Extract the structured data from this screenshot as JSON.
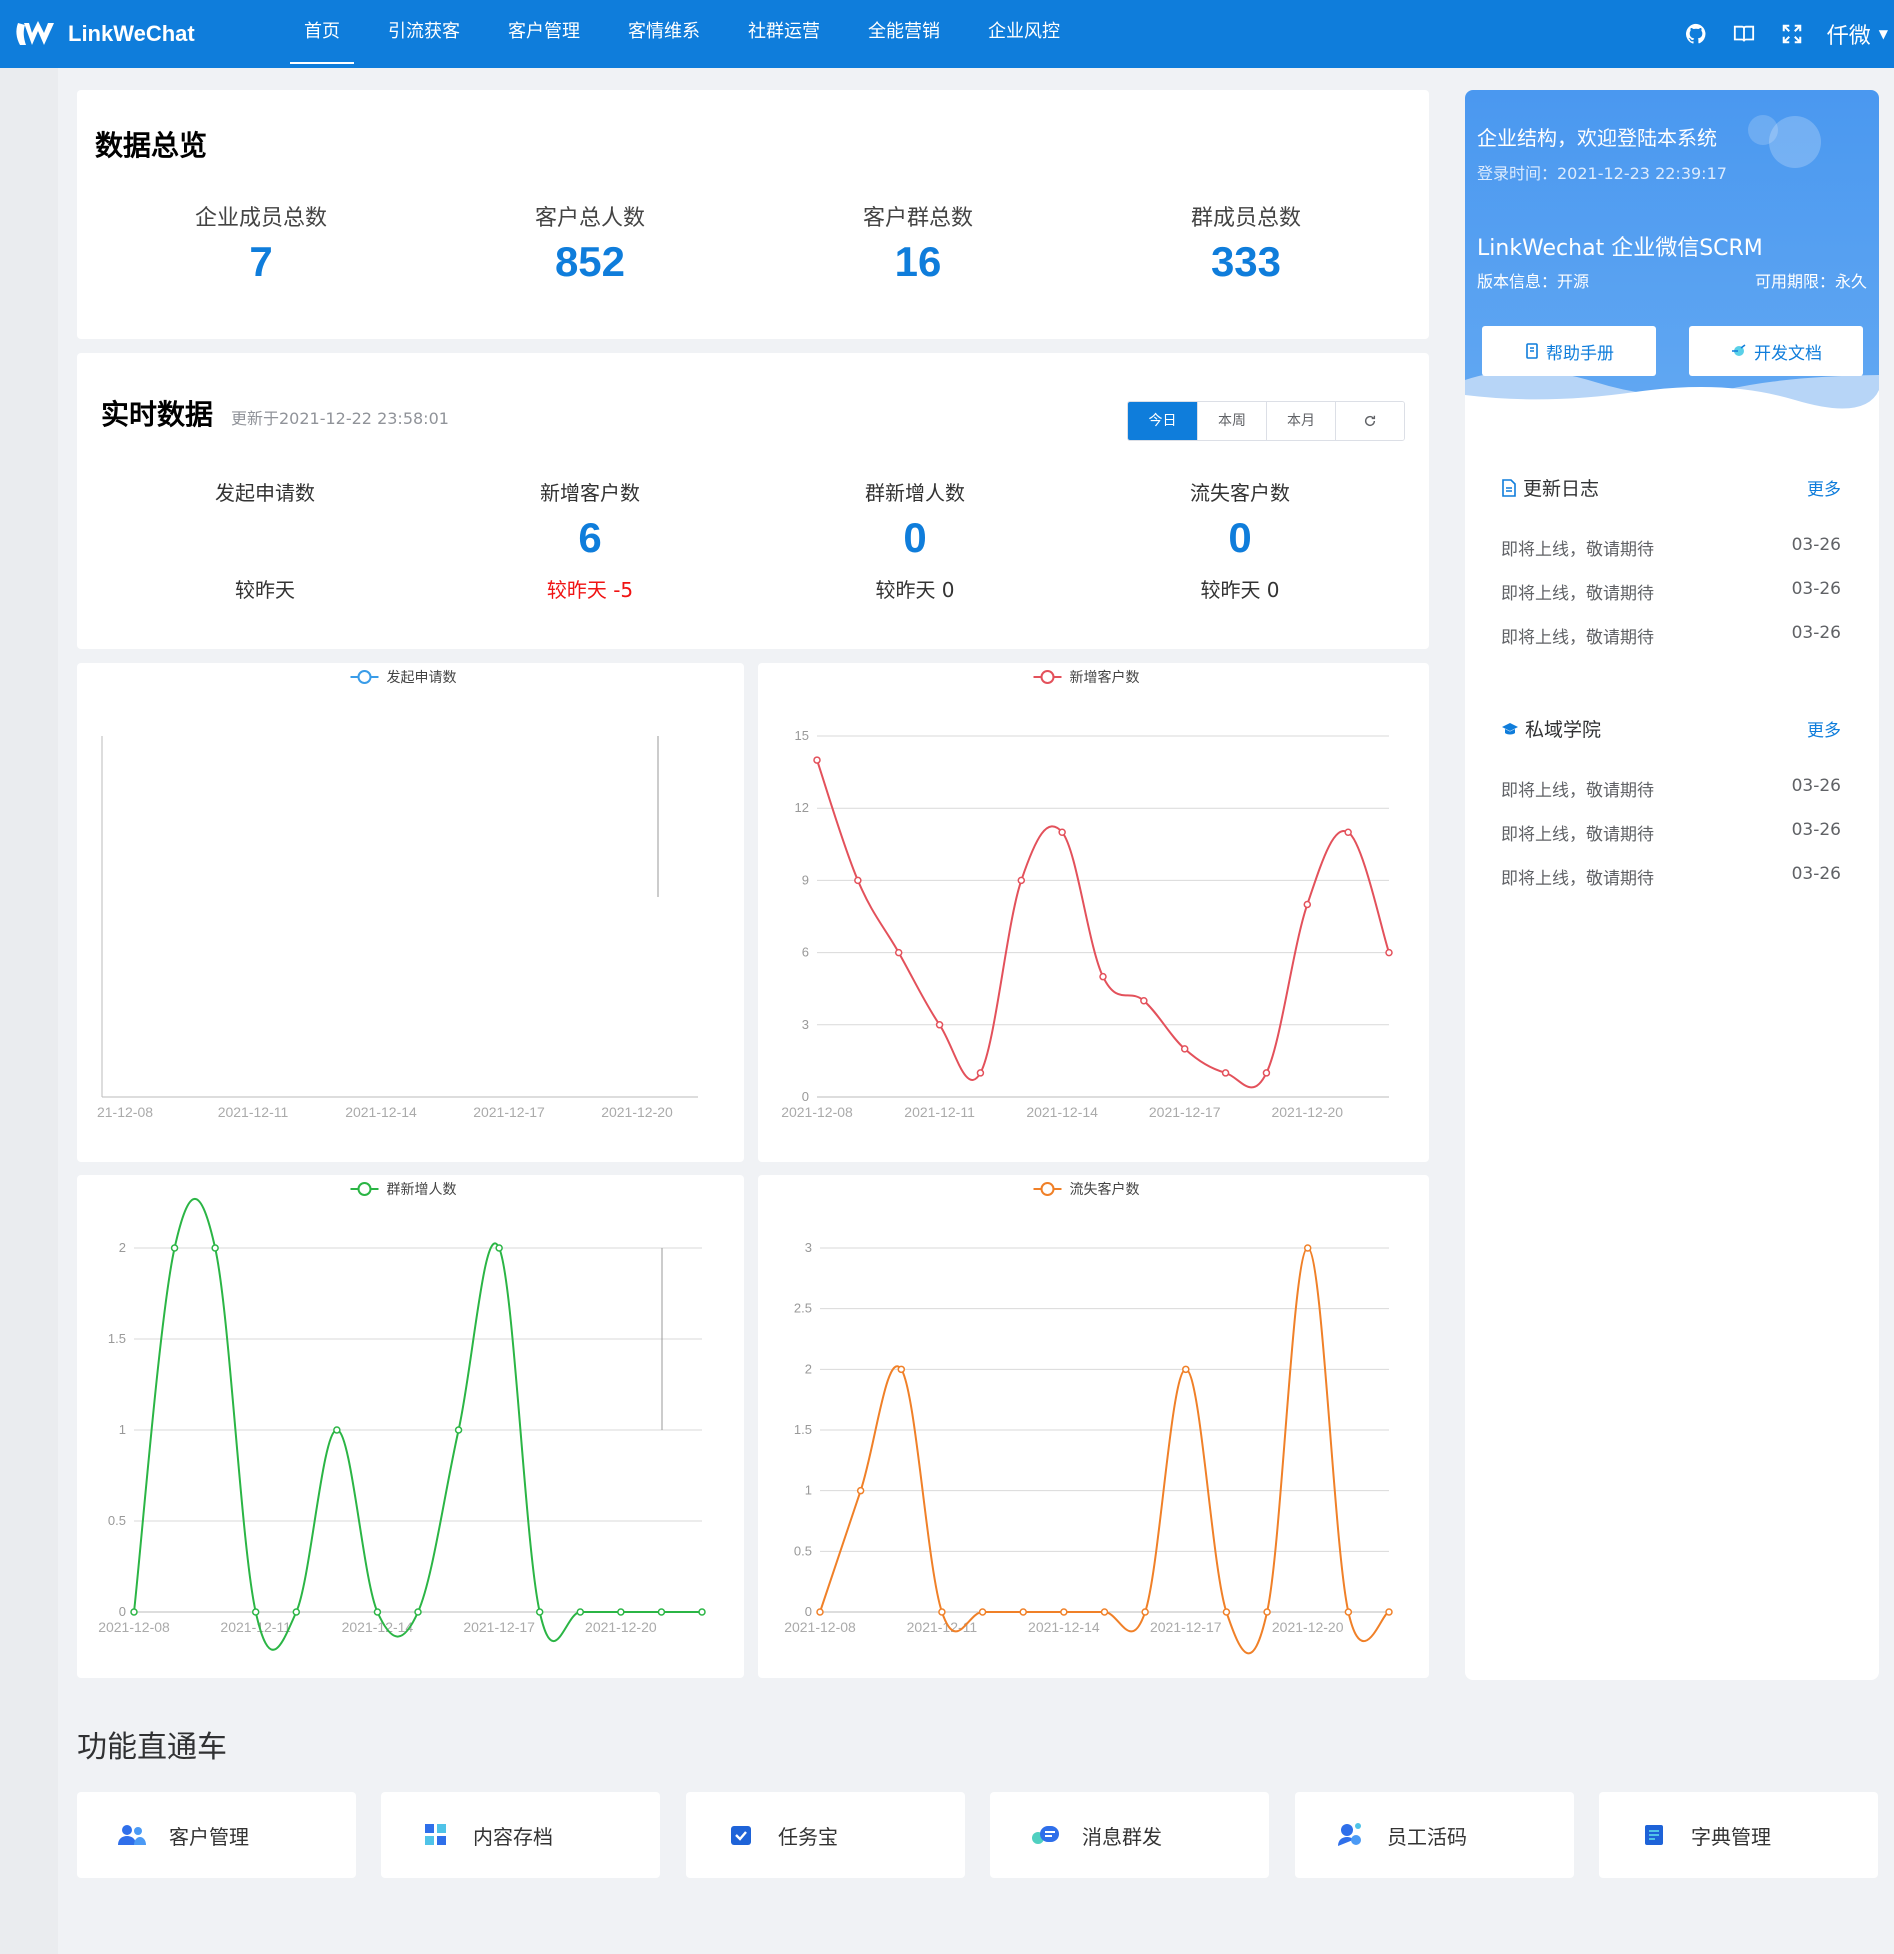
{
  "brand": {
    "name": "LinkWeChat"
  },
  "nav": [
    "首页",
    "引流获客",
    "客户管理",
    "客情维系",
    "社群运营",
    "全能营销",
    "企业风控"
  ],
  "user": {
    "name": "仟微"
  },
  "icons": {
    "top_right": [
      "github-icon",
      "book-icon",
      "fullscreen-icon"
    ]
  },
  "colors": {
    "primary": "#0f7ddb",
    "negative": "#f01313",
    "series": [
      "#3a9ce8",
      "#e3515b",
      "#2bb545",
      "#f08028"
    ]
  },
  "overview": {
    "title": "数据总览",
    "stats": [
      {
        "label": "企业成员总数",
        "value": "7"
      },
      {
        "label": "客户总人数",
        "value": "852"
      },
      {
        "label": "客户群总数",
        "value": "16"
      },
      {
        "label": "群成员总数",
        "value": "333"
      }
    ]
  },
  "realtime": {
    "title": "实时数据",
    "updated": "更新于2021-12-22 23:58:01",
    "periods": [
      "今日",
      "本周",
      "本月"
    ],
    "active_period": "今日",
    "stats": [
      {
        "label": "发起申请数",
        "value": "",
        "compare": "较昨天"
      },
      {
        "label": "新增客户数",
        "value": "6",
        "compare": "较昨天 -5"
      },
      {
        "label": "群新增人数",
        "value": "0",
        "compare": "较昨天 0"
      },
      {
        "label": "流失客户数",
        "value": "0",
        "compare": "较昨天 0"
      }
    ]
  },
  "chart_data": [
    {
      "type": "line",
      "series": [
        {
          "name": "发起申请数",
          "values": []
        }
      ],
      "x": [
        "2021-12-08",
        "2021-12-09",
        "2021-12-10",
        "2021-12-11",
        "2021-12-12",
        "2021-12-13",
        "2021-12-14",
        "2021-12-15",
        "2021-12-16",
        "2021-12-17",
        "2021-12-18",
        "2021-12-19",
        "2021-12-20",
        "2021-12-21",
        "2021-12-22"
      ],
      "tick_labels": [
        "21-12-08",
        "2021-12-11",
        "2021-12-14",
        "2021-12-17",
        "2021-12-20"
      ],
      "yticks": [],
      "ylim": [
        0,
        1
      ]
    },
    {
      "type": "line",
      "series": [
        {
          "name": "新增客户数",
          "values": [
            14,
            9,
            6,
            3,
            1,
            9,
            11,
            5,
            4,
            2,
            1,
            1,
            8,
            11,
            6
          ]
        }
      ],
      "x": [
        "2021-12-08",
        "2021-12-09",
        "2021-12-10",
        "2021-12-11",
        "2021-12-12",
        "2021-12-13",
        "2021-12-14",
        "2021-12-15",
        "2021-12-16",
        "2021-12-17",
        "2021-12-18",
        "2021-12-19",
        "2021-12-20",
        "2021-12-21",
        "2021-12-22"
      ],
      "tick_labels": [
        "2021-12-08",
        "2021-12-11",
        "2021-12-14",
        "2021-12-17",
        "2021-12-20"
      ],
      "yticks": [
        "0",
        "3",
        "6",
        "9",
        "12",
        "15"
      ],
      "ylim": [
        0,
        15
      ]
    },
    {
      "type": "line",
      "series": [
        {
          "name": "群新增人数",
          "values": [
            0,
            2,
            2,
            0,
            0,
            1,
            0,
            0,
            1,
            2,
            0,
            0,
            0,
            0,
            0
          ]
        }
      ],
      "x": [
        "2021-12-08",
        "2021-12-09",
        "2021-12-10",
        "2021-12-11",
        "2021-12-12",
        "2021-12-13",
        "2021-12-14",
        "2021-12-15",
        "2021-12-16",
        "2021-12-17",
        "2021-12-18",
        "2021-12-19",
        "2021-12-20",
        "2021-12-21",
        "2021-12-22"
      ],
      "tick_labels": [
        "2021-12-08",
        "2021-12-11",
        "2021-12-14",
        "2021-12-17",
        "2021-12-20"
      ],
      "yticks": [
        "0",
        "0.5",
        "1",
        "1.5",
        "2"
      ],
      "ylim": [
        0,
        2
      ]
    },
    {
      "type": "line",
      "series": [
        {
          "name": "流失客户数",
          "values": [
            0,
            1,
            2,
            0,
            0,
            0,
            0,
            0,
            0,
            2,
            0,
            0,
            3,
            0,
            0
          ]
        }
      ],
      "x": [
        "2021-12-08",
        "2021-12-09",
        "2021-12-10",
        "2021-12-11",
        "2021-12-12",
        "2021-12-13",
        "2021-12-14",
        "2021-12-15",
        "2021-12-16",
        "2021-12-17",
        "2021-12-18",
        "2021-12-19",
        "2021-12-20",
        "2021-12-21",
        "2021-12-22"
      ],
      "tick_labels": [
        "2021-12-08",
        "2021-12-11",
        "2021-12-14",
        "2021-12-17",
        "2021-12-20"
      ],
      "yticks": [
        "0",
        "0.5",
        "1",
        "1.5",
        "2",
        "2.5",
        "3"
      ],
      "ylim": [
        0,
        3
      ]
    }
  ],
  "panel": {
    "welcome": "企业结构，欢迎登陆本系统",
    "login_time": "登录时间：2021-12-23 22:39:17",
    "product": "LinkWechat 企业微信SCRM",
    "version": "版本信息：开源",
    "validity": "可用期限：永久",
    "help_button": "帮助手册",
    "dev_button": "开发文档",
    "changelog": {
      "title": "更新日志",
      "more": "更多",
      "items": [
        {
          "text": "即将上线，敬请期待",
          "date": "03-26"
        },
        {
          "text": "即将上线，敬请期待",
          "date": "03-26"
        },
        {
          "text": "即将上线，敬请期待",
          "date": "03-26"
        }
      ]
    },
    "academy": {
      "title": "私域学院",
      "more": "更多",
      "items": [
        {
          "text": "即将上线，敬请期待",
          "date": "03-26"
        },
        {
          "text": "即将上线，敬请期待",
          "date": "03-26"
        },
        {
          "text": "即将上线，敬请期待",
          "date": "03-26"
        }
      ]
    }
  },
  "shortcuts": {
    "title": "功能直通车",
    "items": [
      {
        "label": "客户管理",
        "icon": "users-icon"
      },
      {
        "label": "内容存档",
        "icon": "grid-icon"
      },
      {
        "label": "任务宝",
        "icon": "task-check-icon"
      },
      {
        "label": "消息群发",
        "icon": "message-icon"
      },
      {
        "label": "员工活码",
        "icon": "staff-code-icon"
      },
      {
        "label": "字典管理",
        "icon": "dictionary-icon"
      }
    ]
  }
}
